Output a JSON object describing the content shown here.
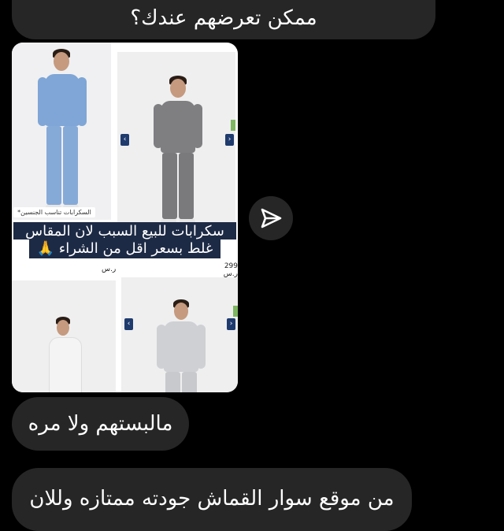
{
  "messages": [
    {
      "id": "m1",
      "text": "ممكن تعرضهم عندك؟"
    },
    {
      "id": "m2",
      "text": "مالبستهم ولا مره"
    },
    {
      "id": "m3",
      "text": "من موقع سوار القماش جودته ممتازه وللان"
    }
  ],
  "shared_image": {
    "caption_line1": "سكرابات للبيع السبب لان المقاس",
    "caption_line2": "غلط بسعر اقل من الشراء 🙏",
    "size_chart_label": "السكرابات تناسب الجنسين*",
    "price_1": "ر.س",
    "price_2": "299 ر.س"
  },
  "share_button": {
    "icon": "send-icon"
  },
  "colors": {
    "background": "#000000",
    "bubble": "#262626",
    "scrub_blue": "#7fa6d6",
    "scrub_gray": "#7f7f82",
    "scrub_light_gray": "#cfd0d4",
    "caption_bg": "#1d2a45"
  }
}
